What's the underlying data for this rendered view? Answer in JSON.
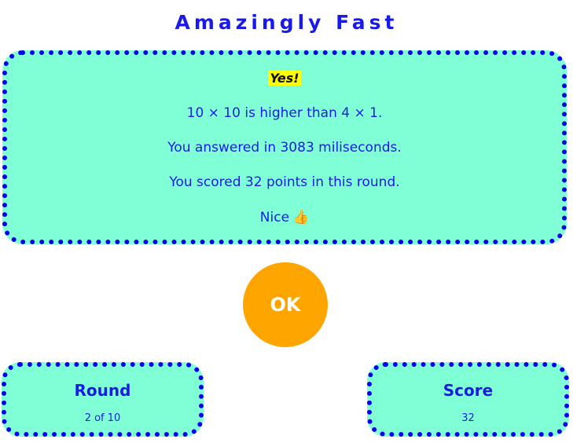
{
  "app": {
    "title": "Amazingly Fast"
  },
  "result": {
    "verdict": "Yes!",
    "comparison": "10 × 10 is higher than 4 × 1.",
    "time": "You answered in 3083 miliseconds.",
    "points": "You scored 32 points in this round.",
    "praise": "Nice",
    "praise_icon": "thumbs-up-icon"
  },
  "actions": {
    "ok_label": "OK"
  },
  "stats": {
    "round_label": "Round",
    "round_value": "2 of 10",
    "score_label": "Score",
    "score_value": "32"
  },
  "colors": {
    "accent": "#1a1ae6",
    "panel": "#80ffd6",
    "border": "#0000ee",
    "button": "#ffa500",
    "highlight": "#ffff00"
  }
}
